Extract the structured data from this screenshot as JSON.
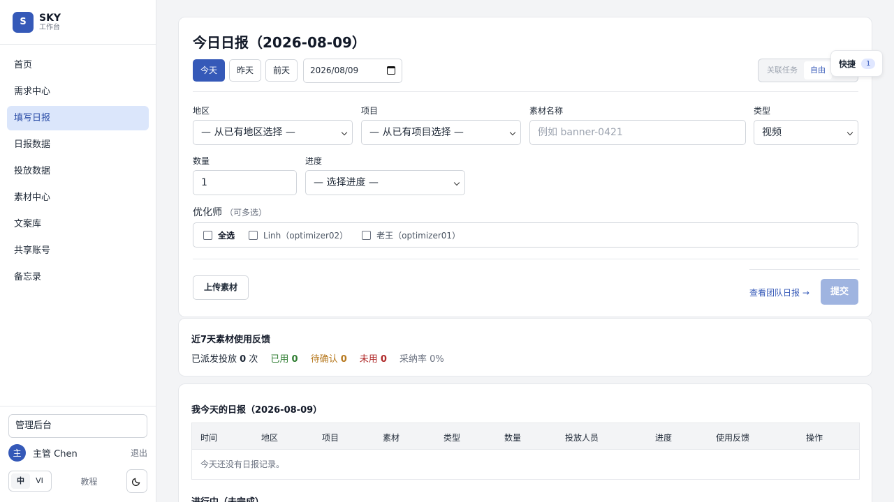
{
  "brand": {
    "logo_letter": "S",
    "name": "SKY",
    "subtitle": "工作台"
  },
  "nav": [
    {
      "label": "首页",
      "active": false
    },
    {
      "label": "需求中心",
      "active": false
    },
    {
      "label": "填写日报",
      "active": true
    },
    {
      "label": "日报数据",
      "active": false
    },
    {
      "label": "投放数据",
      "active": false
    },
    {
      "label": "素材中心",
      "active": false
    },
    {
      "label": "文案库",
      "active": false
    },
    {
      "label": "共享账号",
      "active": false
    },
    {
      "label": "备忘录",
      "active": false
    }
  ],
  "sidebar_bottom": {
    "admin_label": "管理后台",
    "user_avatar": "主",
    "user_name": "主管 Chen",
    "logout_label": "退出",
    "lang_zh": "中",
    "lang_vi": "VI",
    "tutorial_label": "教程",
    "theme_icon": "moon-icon"
  },
  "daily": {
    "title": "今日日报（2026-08-09）",
    "btn_today": "今天",
    "btn_yesterday": "昨天",
    "btn_daybefore": "前天",
    "date_value": "2026/08/09",
    "mode_linked": "关联任务",
    "mode_free": "自由",
    "labels": {
      "region": "地区",
      "project": "项目",
      "material": "素材名称",
      "type": "类型",
      "quantity": "数量",
      "progress": "进度"
    },
    "region_value": "— 从已有地区选择 —",
    "project_value": "— 从已有项目选择 —",
    "material_placeholder": "例如 banner-0421",
    "type_value": "视频",
    "quantity_value": "1",
    "progress_value": "— 选择进度 —",
    "optimizer_label": "优化师",
    "optimizer_hint": "（可多选）",
    "optimizers": [
      "全选",
      "Linh（optimizer02）",
      "老王（optimizer01）"
    ],
    "upload_label": "上传素材",
    "team_link": "查看团队日报 →",
    "submit_label": "提交"
  },
  "shortcut": {
    "label": "快捷",
    "count": "1"
  },
  "feedback": {
    "title": "近7天素材使用反馈",
    "dispatched_prefix": "已派发投放",
    "dispatched_count": "0",
    "dispatched_suffix": "次",
    "used_label": "已用",
    "used_count": "0",
    "pending_label": "待确认",
    "pending_count": "0",
    "unused_label": "未用",
    "unused_count": "0",
    "rate_label": "采纳率 0%"
  },
  "my_reports": {
    "title": "我今天的日报（2026-08-09）",
    "columns": [
      "时间",
      "地区",
      "项目",
      "素材",
      "类型",
      "数量",
      "投放人员",
      "进度",
      "使用反馈",
      "操作"
    ],
    "empty_text": "今天还没有日报记录。",
    "in_progress_title": "进行中（未完成）"
  },
  "colors": {
    "accent": "#3559b8",
    "used": "#2f7d32",
    "pending": "#b7791f",
    "unused": "#b02a2a"
  }
}
